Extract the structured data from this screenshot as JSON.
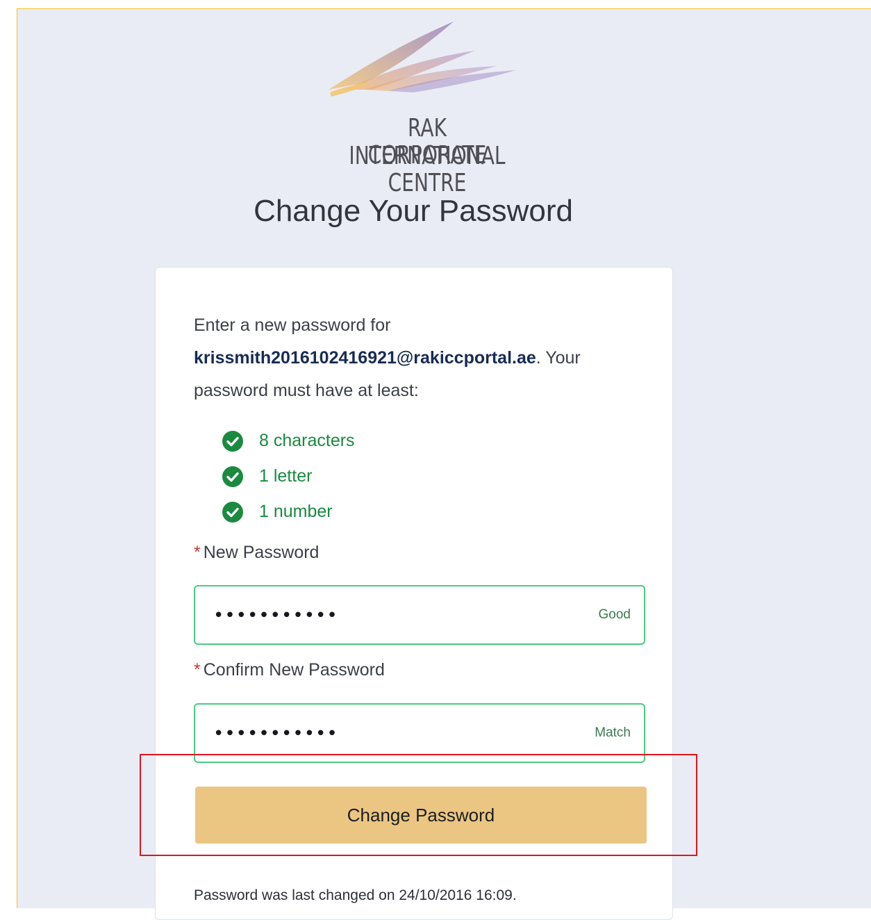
{
  "brand": {
    "line1": "RAK INTERNATIONAL",
    "line2": "CORPORATE CENTRE",
    "logo_icon": "wing-logo-icon",
    "colors": {
      "wing_gold": "#f0b46a",
      "wing_purple": "#a78cc4"
    }
  },
  "page": {
    "title": "Change Your Password",
    "background": "#e9ecf4"
  },
  "form": {
    "intro_before": "Enter a new password for ",
    "username": "krissmith2016102416921@rakiccportal.ae",
    "intro_after": ". Your password must have at least:",
    "requirements": [
      {
        "label": "8 characters",
        "icon": "check-circle-icon",
        "met": true
      },
      {
        "label": "1 letter",
        "icon": "check-circle-icon",
        "met": true
      },
      {
        "label": "1 number",
        "icon": "check-circle-icon",
        "met": true
      }
    ],
    "new_password": {
      "required_mark": "*",
      "label": "New Password",
      "value": "•••••••••••",
      "status": "Good"
    },
    "confirm_password": {
      "required_mark": "*",
      "label": "Confirm New Password",
      "value": "•••••••••••",
      "status": "Match"
    },
    "submit_label": "Change Password",
    "last_changed": "Password was last changed on 24/10/2016 16:09."
  },
  "colors": {
    "success": "#198a3f",
    "input_border_valid": "#4bca81",
    "button": "#ebc683",
    "highlight": "#e0151d"
  }
}
